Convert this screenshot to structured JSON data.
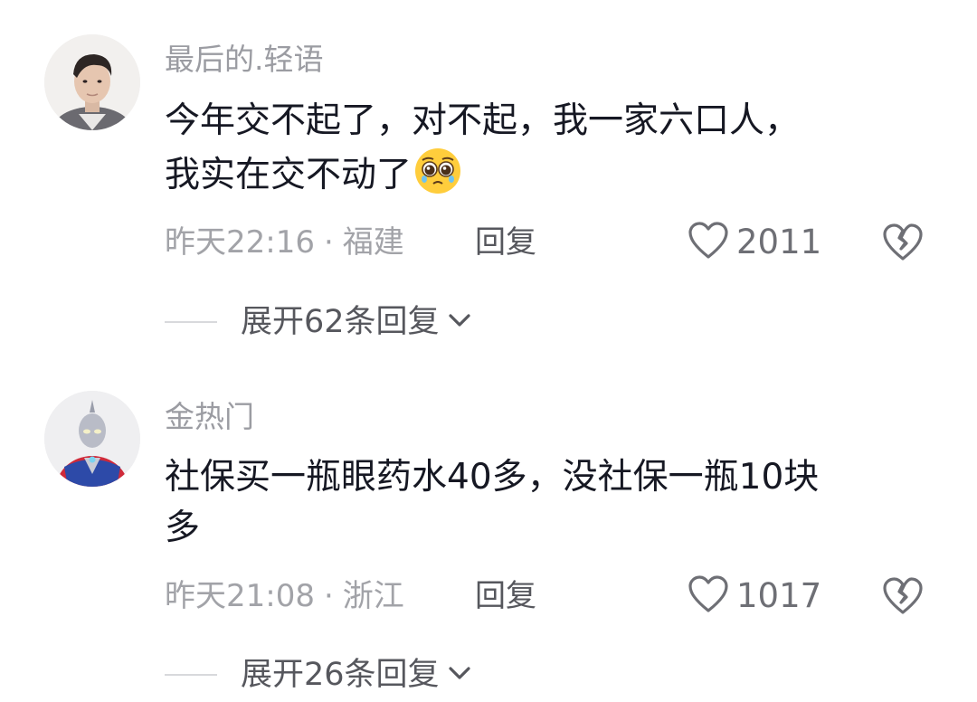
{
  "comments": [
    {
      "username": "最后的.轻语",
      "text_lines": [
        "今年交不起了，对不起，我一家六口人，",
        "我实在交不动了"
      ],
      "emoji": "pleading-face-emoji",
      "time": "昨天22:16",
      "separator": "·",
      "location": "福建",
      "reply_label": "回复",
      "likes": "2011",
      "expand_label": "展开62条回复",
      "avatar": "man-portrait"
    },
    {
      "username": "金热门",
      "text_lines": [
        "社保买一瓶眼药水40多，没社保一瓶10块",
        "多"
      ],
      "time": "昨天21:08",
      "separator": "·",
      "location": "浙江",
      "reply_label": "回复",
      "likes": "1017",
      "expand_label": "展开26条回复",
      "avatar": "ultraman-figure"
    }
  ],
  "icons": {
    "like": "heart-outline-icon",
    "dislike": "broken-heart-icon",
    "expand": "chevron-down-icon"
  },
  "colors": {
    "username": "#9b9ca2",
    "text": "#161823",
    "meta": "#a2a3a8",
    "action": "#56575d"
  }
}
